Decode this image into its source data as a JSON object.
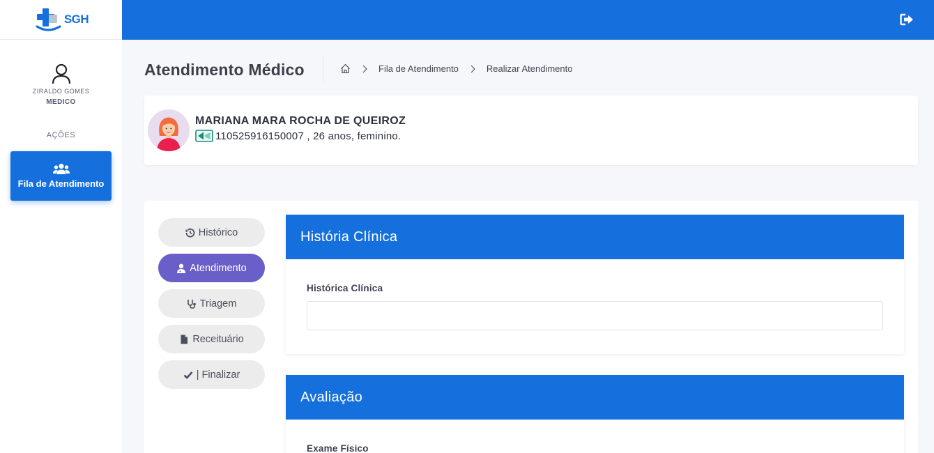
{
  "brand": {
    "name": "SGH"
  },
  "user": {
    "name": "ZIRALDO GOMES",
    "role": "MEDICO"
  },
  "sidebar": {
    "section_label": "AÇÕES",
    "items": [
      {
        "label": "Fila de Atendimento",
        "icon": "users-icon",
        "active": true
      }
    ]
  },
  "header": {
    "title": "Atendimento Médico",
    "breadcrumb": [
      {
        "label": "",
        "icon": "home-icon"
      },
      {
        "label": "Fila de Atendimento"
      },
      {
        "label": "Realizar Atendimento"
      }
    ]
  },
  "patient": {
    "name": "MARIANA MARA ROCHA DE QUEIROZ",
    "info": "110525916150007 , 26 anos, feminino.",
    "card_icon": "id-card-icon"
  },
  "tabs": [
    {
      "label": "Histórico",
      "icon": "history-icon",
      "active": false
    },
    {
      "label": "Atendimento",
      "icon": "user-md-icon",
      "active": true
    },
    {
      "label": "Triagem",
      "icon": "stethoscope-icon",
      "active": false
    },
    {
      "label": "Receituário",
      "icon": "file-icon",
      "active": false
    },
    {
      "label": "| Finalizar",
      "icon": "check-icon",
      "active": false
    }
  ],
  "sections": {
    "historia": {
      "title": "História Clínica",
      "field_label": "Histórica Clínica",
      "field_value": ""
    },
    "avaliacao": {
      "title": "Avaliação",
      "field_label": "Exame Físico"
    }
  },
  "colors": {
    "primary": "#1570de",
    "active_tab": "#6a5fc8",
    "tab_bg": "#ececec",
    "background": "#f6f7fb"
  }
}
